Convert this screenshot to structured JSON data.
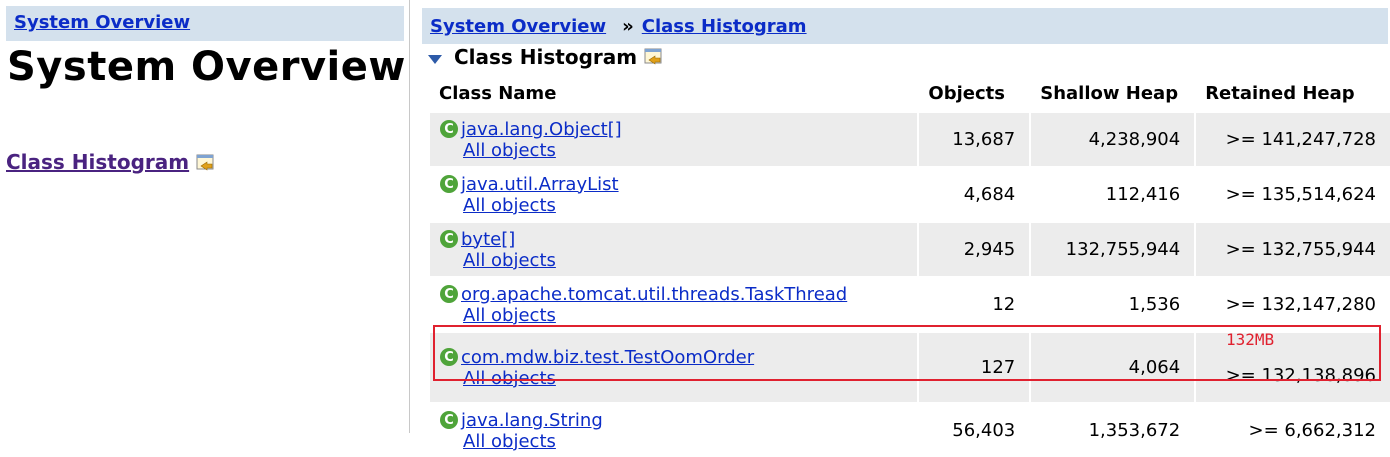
{
  "left": {
    "breadcrumb": "System Overview",
    "title": "System Overview",
    "link": "Class Histogram",
    "link_icon": "open-in-pane-icon"
  },
  "right": {
    "breadcrumb": {
      "first": "System Overview",
      "separator": "»",
      "second": "Class Histogram"
    },
    "section_title": "Class Histogram",
    "section_icon": "open-in-pane-icon",
    "table": {
      "headers": [
        "Class Name",
        "Objects",
        "Shallow Heap",
        "Retained Heap"
      ],
      "rows": [
        {
          "class_name": "java.lang.Object[]",
          "link": "All objects",
          "objects": "13,687",
          "shallow": "4,238,904",
          "retained": ">= 141,247,728"
        },
        {
          "class_name": "java.util.ArrayList",
          "link": "All objects",
          "objects": "4,684",
          "shallow": "112,416",
          "retained": ">= 135,514,624"
        },
        {
          "class_name": "byte[]",
          "link": "All objects",
          "objects": "2,945",
          "shallow": "132,755,944",
          "retained": ">= 132,755,944"
        },
        {
          "class_name": "org.apache.tomcat.util.threads.TaskThread",
          "link": "All objects",
          "objects": "12",
          "shallow": "1,536",
          "retained": ">= 132,147,280"
        },
        {
          "class_name": "com.mdw.biz.test.TestOomOrder",
          "link": "All objects",
          "objects": "127",
          "shallow": "4,064",
          "retained": ">= 132,138,896"
        },
        {
          "class_name": "java.lang.String",
          "link": "All objects",
          "objects": "56,403",
          "shallow": "1,353,672",
          "retained": ">= 6,662,312"
        }
      ]
    },
    "annotation": "132MB",
    "colors": {
      "header_bar": "#d4e1ed",
      "link": "#0b2cc7",
      "visited_link": "#4a2380",
      "class_icon": "#4fa43a",
      "highlight": "#e0212f"
    }
  }
}
